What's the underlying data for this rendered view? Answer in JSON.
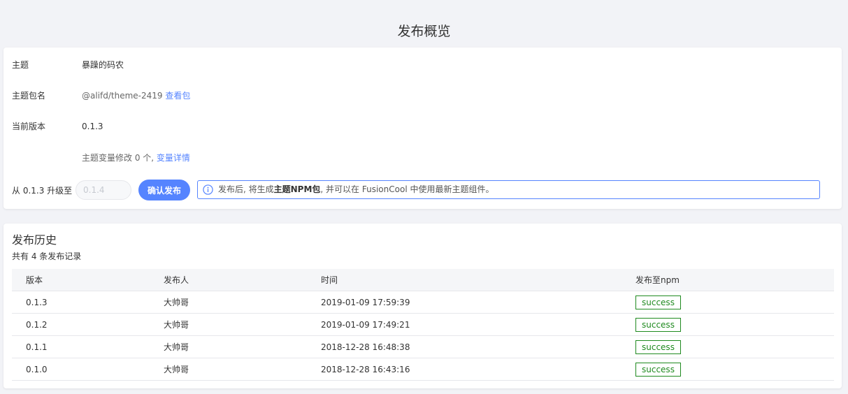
{
  "header": {
    "title": "发布概览"
  },
  "info": {
    "theme_label": "主题",
    "theme_value": "暴躁的码农",
    "package_label": "主题包名",
    "package_value": "@alifd/theme-2419",
    "package_link": "查看包",
    "version_label": "当前版本",
    "version_value": "0.1.3",
    "changes_text": "主题变量修改 0 个,",
    "changes_link": "变量详情"
  },
  "upgrade": {
    "label": "从 0.1.3 升级至",
    "input_placeholder": "0.1.4",
    "confirm_label": "确认发布",
    "notice_prefix": "发布后, 将生成",
    "notice_bold": "主题NPM包",
    "notice_suffix": ", 并可以在 FusionCool 中使用最新主题组件。"
  },
  "history": {
    "title": "发布历史",
    "count_text": "共有 4 条发布记录",
    "columns": [
      "版本",
      "发布人",
      "时间",
      "发布至npm"
    ],
    "rows": [
      {
        "version": "0.1.3",
        "publisher": "大帅哥",
        "time": "2019-01-09 17:59:39",
        "status": "success"
      },
      {
        "version": "0.1.2",
        "publisher": "大帅哥",
        "time": "2019-01-09 17:49:21",
        "status": "success"
      },
      {
        "version": "0.1.1",
        "publisher": "大帅哥",
        "time": "2018-12-28 16:48:38",
        "status": "success"
      },
      {
        "version": "0.1.0",
        "publisher": "大帅哥",
        "time": "2018-12-28 16:43:16",
        "status": "success"
      }
    ]
  },
  "icons": {
    "notice": "info-circle-icon"
  },
  "colors": {
    "accent": "#5584ff",
    "success": "#1f8a1f",
    "background": "#f2f3f7"
  }
}
